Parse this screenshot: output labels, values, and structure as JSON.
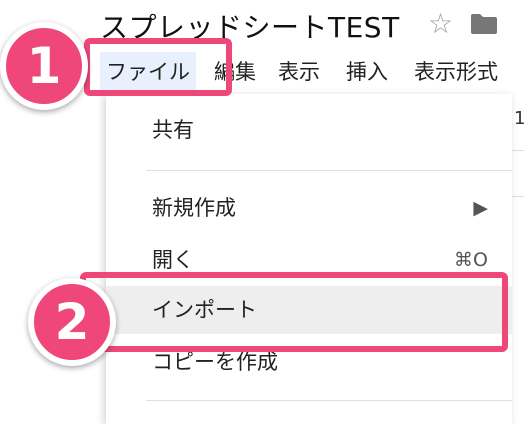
{
  "doc": {
    "title": "スプレッドシートTEST"
  },
  "menubar": {
    "file": "ファイル",
    "edit": "編集",
    "view": "表示",
    "insert": "挿入",
    "format": "表示形式"
  },
  "dropdown": {
    "share": "共有",
    "new": "新規作成",
    "new_submenu_icon": "▶",
    "open": "開く",
    "open_shortcut": "⌘O",
    "import": "インポート",
    "copy": "コピーを作成"
  },
  "callouts": {
    "one": "1",
    "two": "2"
  },
  "sheet": {
    "hint": "1"
  },
  "colors": {
    "accent": "#f0477a",
    "active_menu_bg": "#e8f0fe",
    "highlight_bg": "#eeeeee"
  }
}
